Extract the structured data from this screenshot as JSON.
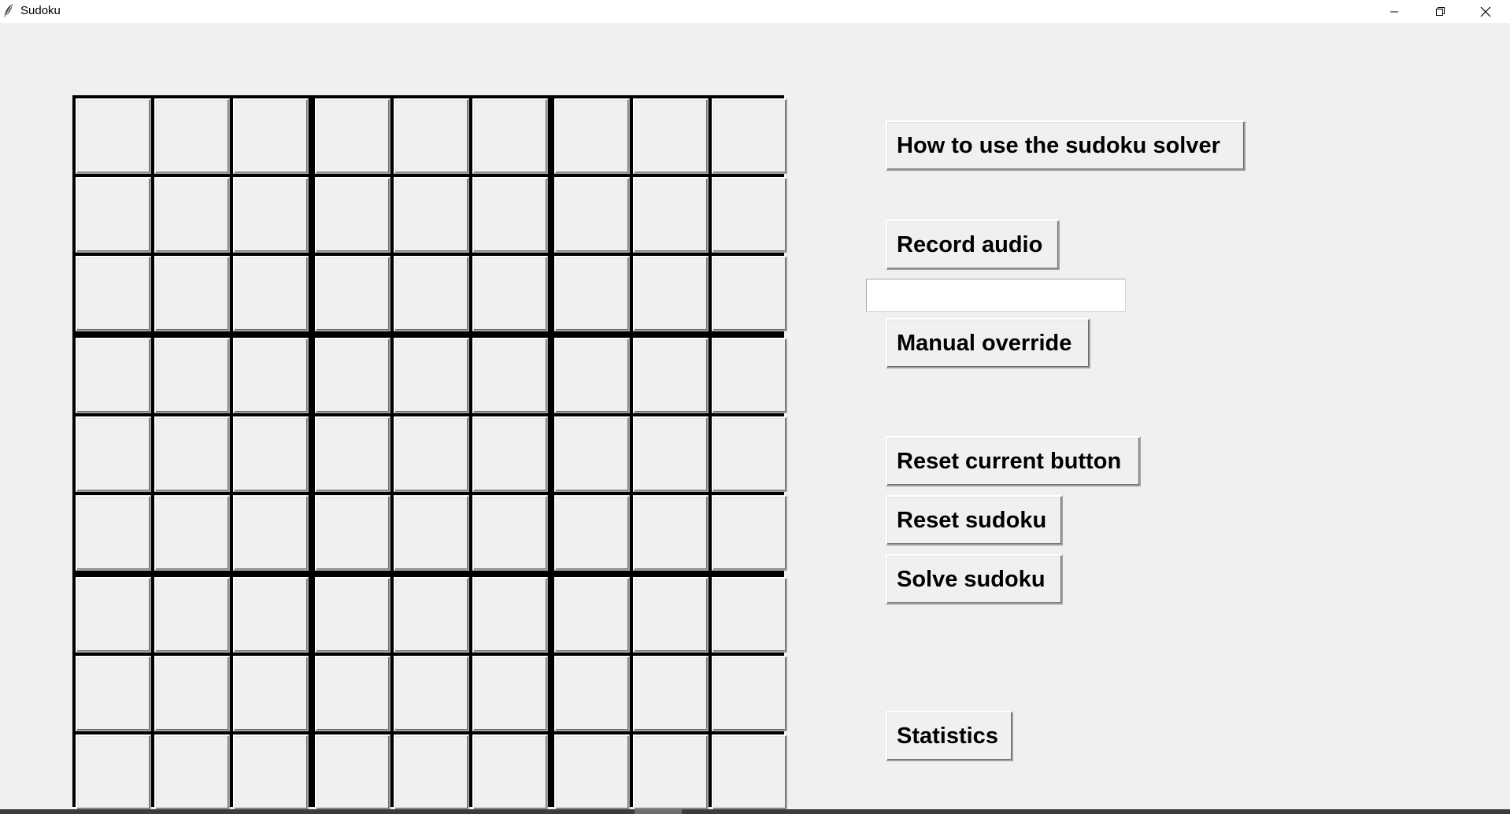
{
  "window": {
    "title": "Sudoku",
    "app_icon": "feather-icon",
    "controls": [
      "minimize-icon",
      "restore-icon",
      "close-icon"
    ]
  },
  "board": {
    "rows": 9,
    "cols": 9,
    "cells": [
      [
        "",
        "",
        "",
        "",
        "",
        "",
        "",
        "",
        ""
      ],
      [
        "",
        "",
        "",
        "",
        "",
        "",
        "",
        "",
        ""
      ],
      [
        "",
        "",
        "",
        "",
        "",
        "",
        "",
        "",
        ""
      ],
      [
        "",
        "",
        "",
        "",
        "",
        "",
        "",
        "",
        ""
      ],
      [
        "",
        "",
        "",
        "",
        "",
        "",
        "",
        "",
        ""
      ],
      [
        "",
        "",
        "",
        "",
        "",
        "",
        "",
        "",
        ""
      ],
      [
        "",
        "",
        "",
        "",
        "",
        "",
        "",
        "",
        ""
      ],
      [
        "",
        "",
        "",
        "",
        "",
        "",
        "",
        "",
        ""
      ],
      [
        "",
        "",
        "",
        "",
        "",
        "",
        "",
        "",
        ""
      ]
    ]
  },
  "controls": {
    "how_to_label": "How to use the sudoku solver",
    "record_audio_label": "Record audio",
    "override_input_value": "",
    "manual_override_label": "Manual override",
    "reset_current_label": "Reset current button",
    "reset_sudoku_label": "Reset sudoku",
    "solve_sudoku_label": "Solve sudoku",
    "statistics_label": "Statistics"
  },
  "colors": {
    "window_bg": "#f0f0f0",
    "grid_lines": "#000000",
    "titlebar_bg": "#ffffff"
  }
}
